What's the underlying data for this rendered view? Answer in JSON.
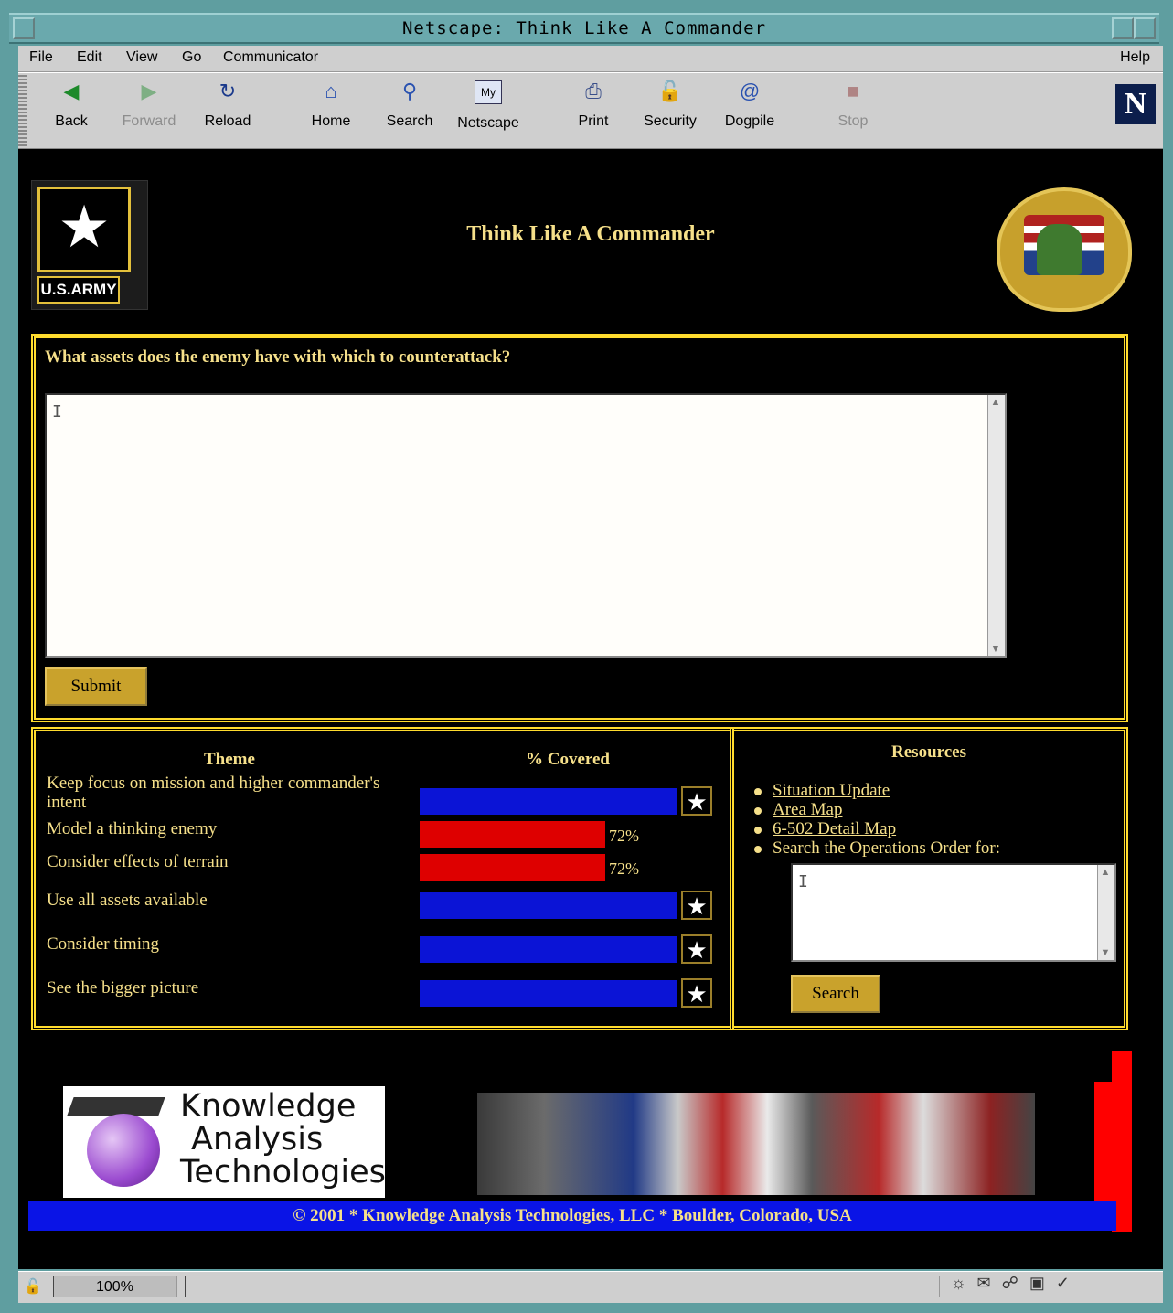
{
  "window": {
    "title": "Netscape: Think Like A Commander"
  },
  "menu": {
    "file": "File",
    "edit": "Edit",
    "view": "View",
    "go": "Go",
    "communicator": "Communicator",
    "help": "Help"
  },
  "toolbar": {
    "back": "Back",
    "forward": "Forward",
    "reload": "Reload",
    "home": "Home",
    "search": "Search",
    "netscape": "Netscape",
    "print": "Print",
    "security": "Security",
    "dogpile": "Dogpile",
    "stop": "Stop",
    "my_badge": "My",
    "netscape_logo": "N"
  },
  "page": {
    "title": "Think Like A Commander",
    "army_logo_text": "U.S.ARMY",
    "question": "What assets does the enemy have with which to counterattack?",
    "answer_value": "",
    "submit_label": "Submit"
  },
  "themes": {
    "header_theme": "Theme",
    "header_covered": "% Covered",
    "rows": [
      {
        "label": "Keep focus on mission and higher commander's intent",
        "covered": 100,
        "complete": true
      },
      {
        "label": "Model a thinking enemy",
        "covered": 72,
        "pct_text": "72%",
        "complete": false
      },
      {
        "label": "Consider effects of terrain",
        "covered": 72,
        "pct_text": "72%",
        "complete": false
      },
      {
        "label": "Use all assets available",
        "covered": 100,
        "complete": true
      },
      {
        "label": "Consider timing",
        "covered": 100,
        "complete": true
      },
      {
        "label": "See the bigger picture",
        "covered": 100,
        "complete": true
      }
    ]
  },
  "resources": {
    "title": "Resources",
    "links": [
      "Situation Update",
      "Area Map",
      "6-502 Detail Map"
    ],
    "search_text": "Search the Operations Order for:",
    "search_value": "",
    "search_label": "Search"
  },
  "footer": {
    "company_logo_lines": [
      "Knowledge",
      "Analysis",
      "Technologies"
    ],
    "copyright": "© 2001  *   Knowledge Analysis Technologies, LLC  *  Boulder, Colorado, USA"
  },
  "status": {
    "zoom": "100%"
  },
  "colors": {
    "accent": "#f6e08a",
    "panel_border": "#ffdc2e",
    "bar_complete": "#0b14d6",
    "bar_partial": "#de0000",
    "button": "#c9a22c"
  }
}
